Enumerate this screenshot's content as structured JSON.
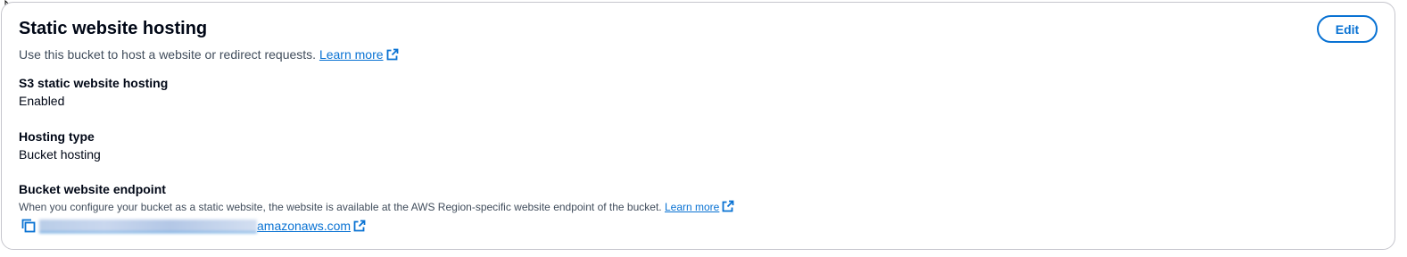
{
  "section": {
    "title": "Static website hosting",
    "description": "Use this bucket to host a website or redirect requests.",
    "learn_more": "Learn more",
    "edit_label": "Edit"
  },
  "fields": {
    "hosting": {
      "label": "S3 static website hosting",
      "value": "Enabled"
    },
    "hosting_type": {
      "label": "Hosting type",
      "value": "Bucket hosting"
    },
    "endpoint": {
      "label": "Bucket website endpoint",
      "description": "When you configure your bucket as a static website, the website is available at the AWS Region-specific website endpoint of the bucket.",
      "learn_more": "Learn more",
      "url_visible_suffix": "amazonaws.com"
    }
  },
  "icons": {
    "external_link": "external-link-icon",
    "copy": "copy-icon",
    "cursor": "mouse-cursor-icon"
  },
  "colors": {
    "link": "#0972d3",
    "text": "#000716",
    "muted": "#414d5c",
    "border": "#c6c6cd"
  }
}
